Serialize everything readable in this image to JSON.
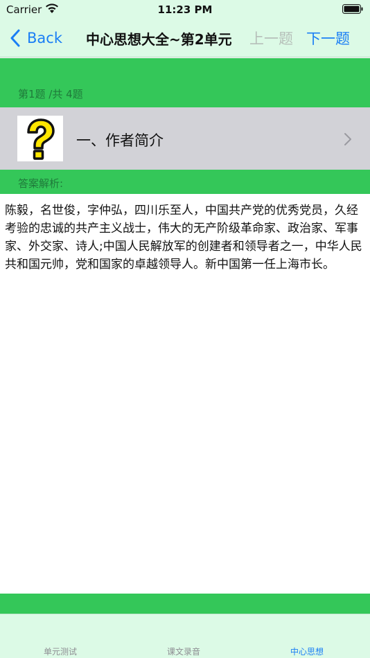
{
  "status_bar": {
    "carrier": "Carrier",
    "time": "11:23 PM"
  },
  "nav": {
    "back_label": "Back",
    "title": "中心思想大全~第2单元",
    "prev_label": "上一题",
    "next_label": "下一题"
  },
  "question": {
    "counter": "第1题 /共 4题",
    "label": "一、作者简介",
    "icon": "question-mark-icon"
  },
  "answer": {
    "header": "答案解析:",
    "text": "陈毅，名世俊，字仲弘，四川乐至人，中国共产党的优秀党员，久经考验的忠诚的共产主义战士，伟大的无产阶级革命家、政治家、军事家、外交家、诗人;中国人民解放军的创建者和领导者之一，中华人民共和国元帅，党和国家的卓越领导人。新中国第一任上海市长。"
  },
  "tabs": [
    {
      "label": "单元测试",
      "active": false
    },
    {
      "label": "课文录音",
      "active": false
    },
    {
      "label": "中心思想",
      "active": true
    }
  ],
  "colors": {
    "accent": "#1a7ef5",
    "green": "#34c759",
    "nav_bg": "#dcfae6",
    "row_bg": "#d2d2d7"
  }
}
